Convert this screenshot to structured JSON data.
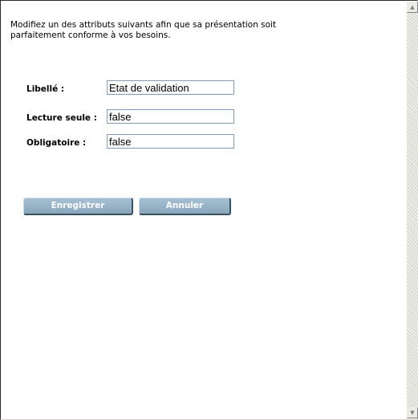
{
  "intro": {
    "line1": "Modifiez un des attributs suivants afin que sa présentation soit",
    "line2": "parfaitement conforme à vos besoins."
  },
  "form": {
    "fields": [
      {
        "label": "Libellé :",
        "value": "Etat de validation"
      },
      {
        "label": "Lecture seule :",
        "value": "false"
      },
      {
        "label": "Obligatoire :",
        "value": "false"
      }
    ]
  },
  "buttons": {
    "save_label": "Enregistrer",
    "cancel_label": "Annuler"
  },
  "scrollbar": {
    "up_icon": "triangle-up-icon",
    "down_icon": "triangle-down-icon"
  },
  "colors": {
    "button_fill": "#98b3c8",
    "button_text": "#ffffff",
    "input_border": "#7f9db9"
  }
}
